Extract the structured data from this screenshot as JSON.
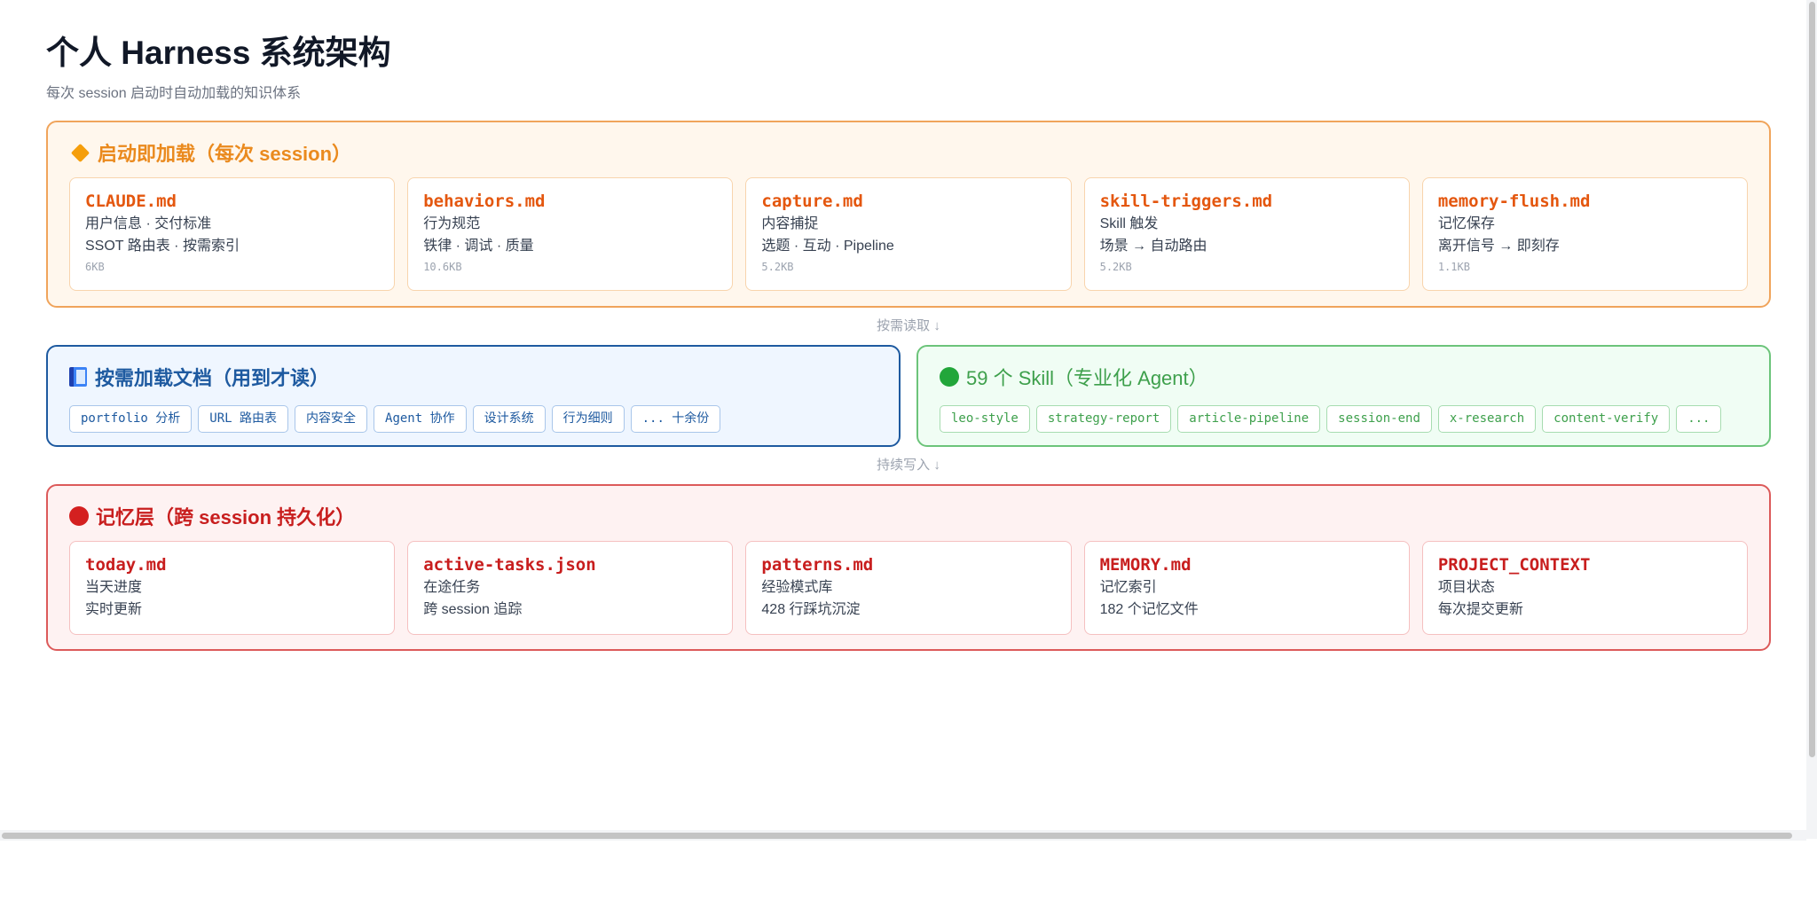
{
  "header": {
    "title": "个人 Harness 系统架构",
    "subtitle": "每次 session 启动时自动加载的知识体系"
  },
  "startup": {
    "heading": "启动即加载（每次 session）",
    "icon": "orange-diamond-icon",
    "files": [
      {
        "name": "CLAUDE.md",
        "line1": "用户信息 · 交付标准",
        "line2": "SSOT 路由表 · 按需索引",
        "size": "6KB"
      },
      {
        "name": "behaviors.md",
        "line1": "行为规范",
        "line2": "铁律 · 调试 · 质量",
        "size": "10.6KB"
      },
      {
        "name": "capture.md",
        "line1": "内容捕捉",
        "line2": "选题 · 互动 · Pipeline",
        "size": "5.2KB"
      },
      {
        "name": "skill-triggers.md",
        "line1": "Skill 触发",
        "line2": "场景 → 自动路由",
        "size": "5.2KB"
      },
      {
        "name": "memory-flush.md",
        "line1": "记忆保存",
        "line2": "离开信号 → 即刻存",
        "size": "1.1KB"
      }
    ]
  },
  "arrow1": "按需读取 ↓",
  "docs": {
    "heading": "按需加载文档（用到才读）",
    "icon": "blue-book-icon",
    "tags": [
      "portfolio 分析",
      "URL 路由表",
      "内容安全",
      "Agent 协作",
      "设计系统",
      "行为细则",
      "... 十余份"
    ]
  },
  "skills": {
    "heading": "59 个 Skill（专业化 Agent）",
    "icon": "green-circle-icon",
    "tags": [
      "leo-style",
      "strategy-report",
      "article-pipeline",
      "session-end",
      "x-research",
      "content-verify",
      "..."
    ]
  },
  "arrow2": "持续写入 ↓",
  "memory": {
    "heading": "记忆层（跨 session 持久化）",
    "icon": "red-circle-icon",
    "files": [
      {
        "name": "today.md",
        "line1": "当天进度",
        "line2": "实时更新"
      },
      {
        "name": "active-tasks.json",
        "line1": "在途任务",
        "line2": "跨 session 追踪"
      },
      {
        "name": "patterns.md",
        "line1": "经验模式库",
        "line2": "428 行踩坑沉淀"
      },
      {
        "name": "MEMORY.md",
        "line1": "记忆索引",
        "line2": "182 个记忆文件"
      },
      {
        "name": "PROJECT_CONTEXT",
        "line1": "项目状态",
        "line2": "每次提交更新"
      }
    ]
  },
  "colors": {
    "startup_accent": "#ea8a1e",
    "docs_accent": "#1e5aa0",
    "skills_accent": "#3ea04c",
    "memory_accent": "#c81e1e"
  }
}
